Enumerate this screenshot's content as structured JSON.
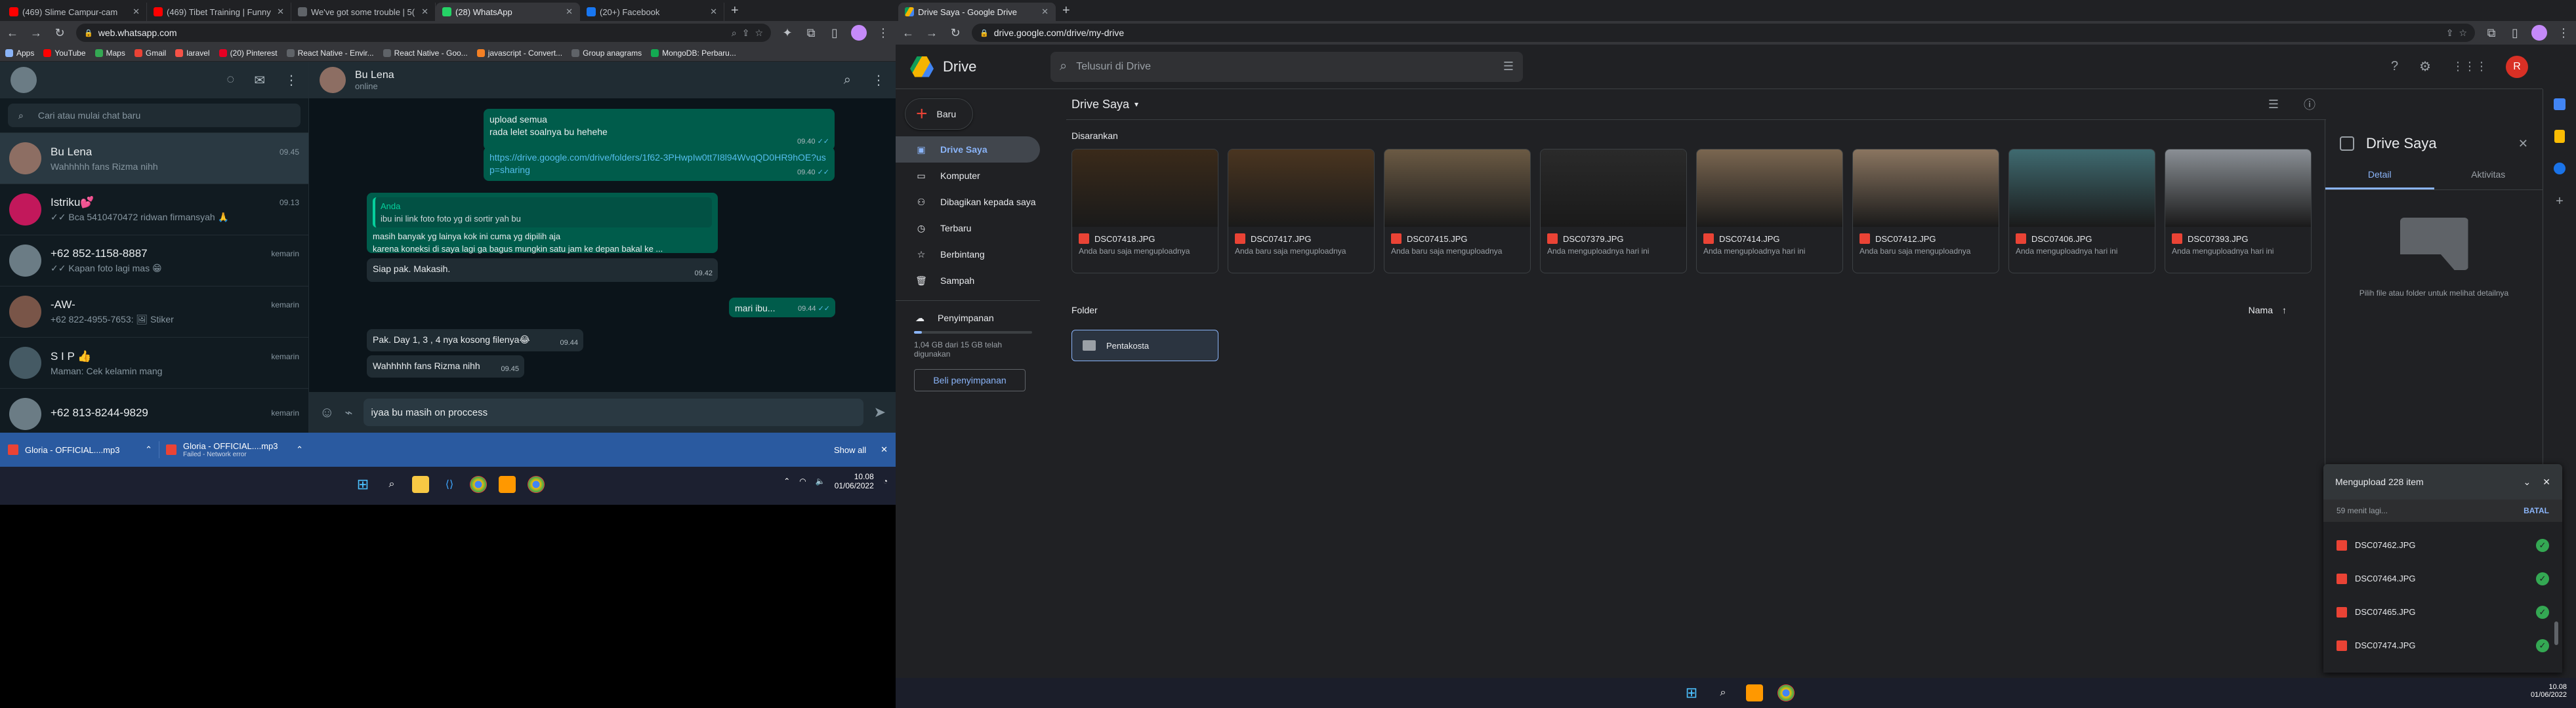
{
  "left_browser": {
    "tabs": [
      {
        "title": "(469) Slime Campur-cam",
        "color": "#ff0000"
      },
      {
        "title": "(469) Tibet Training | Funny",
        "color": "#ff0000"
      },
      {
        "title": "We've got some trouble | 5(",
        "color": "#5f6368"
      },
      {
        "title": "(28) WhatsApp",
        "color": "#25d366"
      },
      {
        "title": "(20+) Facebook",
        "color": "#1877f2"
      }
    ],
    "url": "web.whatsapp.com",
    "bookmarks": [
      {
        "label": "Apps",
        "color": "#8ab4f8"
      },
      {
        "label": "YouTube",
        "color": "#ff0000"
      },
      {
        "label": "Maps",
        "color": "#34a853"
      },
      {
        "label": "Gmail",
        "color": "#ea4335"
      },
      {
        "label": "laravel",
        "color": "#f55247"
      },
      {
        "label": "(20) Pinterest",
        "color": "#e60023"
      },
      {
        "label": "React Native - Envir...",
        "color": "#5f6368"
      },
      {
        "label": "React Native - Goo...",
        "color": "#5f6368"
      },
      {
        "label": "javascript - Convert...",
        "color": "#f48024"
      },
      {
        "label": "Group anagrams",
        "color": "#5f6368"
      },
      {
        "label": "MongoDB: Perbaru...",
        "color": "#13aa52"
      }
    ]
  },
  "whatsapp": {
    "search_placeholder": "Cari atau mulai chat baru",
    "chats": [
      {
        "name": "Bu Lena",
        "time": "09.45",
        "msg": "Wahhhhh fans Rizma nihh",
        "selected": true
      },
      {
        "name": "Istriku💕",
        "time": "09.13",
        "msg": "✓✓ Bca 5410470472  ridwan firmansyah 🙏",
        "selected": false
      },
      {
        "name": "+62 852-1158-8887",
        "time": "kemarin",
        "msg": "✓✓ Kapan foto lagi mas 😁",
        "selected": false
      },
      {
        "name": "-AW-",
        "time": "kemarin",
        "msg": "+62 822-4955-7653: 🖼 Stiker",
        "selected": false
      },
      {
        "name": "S I P 👍",
        "time": "kemarin",
        "msg": "Maman: Cek kelamin mang",
        "selected": false
      },
      {
        "name": "+62 813-8244-9829",
        "time": "kemarin",
        "msg": "",
        "selected": false
      }
    ],
    "contact": {
      "name": "Bu Lena",
      "status": "online"
    },
    "messages": {
      "m1_line1": "upload semua",
      "m1_line2": "rada lelet soalnya bu hehehe",
      "m1_time": "09.40",
      "m2_link": "https://drive.google.com/drive/folders/1f62-3PHwpIw0tt7I8l94WvqQD0HR9hOE?usp=sharing",
      "m2_time": "09.40",
      "quote_author": "Anda",
      "quote_text": "ibu ini link foto foto yg di sortir yah bu",
      "m3_line1": "masih banyak yg lainya kok ini cuma yg dipilih aja",
      "m3_line2": "karena koneksi di saya lagi ga bagus mungkin satu jam ke depan bakal ke ...",
      "m4_text": "Siap pak. Makasih.",
      "m4_time": "09.42",
      "m5_text": "mari ibu...",
      "m5_time": "09.44",
      "m6_text": "Pak. Day 1, 3 , 4 nya kosong filenya😂",
      "m6_time": "09.44",
      "m7_text": "Wahhhhh fans Rizma nihh",
      "m7_time": "09.45"
    },
    "composer_text": "iyaa bu masih on proccess"
  },
  "downloads": {
    "items": [
      {
        "name": "Gloria - OFFICIAL....mp3",
        "status": ""
      },
      {
        "name": "Gloria - OFFICIAL....mp3",
        "status": "Failed - Network error"
      }
    ],
    "show_all": "Show all"
  },
  "taskbar": {
    "time": "10.08",
    "date": "01/06/2022"
  },
  "right_browser": {
    "tab_title": "Drive Saya - Google Drive",
    "url": "drive.google.com/drive/my-drive"
  },
  "drive": {
    "logo_text": "Drive",
    "search_placeholder": "Telusuri di Drive",
    "avatar_letter": "R",
    "new_button": "Baru",
    "nav": [
      {
        "label": "Drive Saya",
        "icon": "drive-icon",
        "glyph": "▣",
        "active": true
      },
      {
        "label": "Komputer",
        "icon": "computer-icon",
        "glyph": "▭",
        "active": false
      },
      {
        "label": "Dibagikan kepada saya",
        "icon": "shared-icon",
        "glyph": "⚇",
        "active": false
      },
      {
        "label": "Terbaru",
        "icon": "clock-icon",
        "glyph": "◷",
        "active": false
      },
      {
        "label": "Berbintang",
        "icon": "star-icon",
        "glyph": "☆",
        "active": false
      },
      {
        "label": "Sampah",
        "icon": "trash-icon",
        "glyph": "🗑",
        "active": false
      }
    ],
    "storage_label": "Penyimpanan",
    "storage_usage": "1,04 GB dari 15 GB telah digunakan",
    "storage_fraction": 0.069,
    "buy_storage": "Beli penyimpanan",
    "breadcrumb": "Drive Saya",
    "suggested_label": "Disarankan",
    "suggested_files": [
      {
        "name": "DSC07418.JPG",
        "sub": "Anda baru saja mengupload­nya",
        "tone": "#3a2a1a"
      },
      {
        "name": "DSC07417.JPG",
        "sub": "Anda baru saja mengupload­nya",
        "tone": "#4a3520"
      },
      {
        "name": "DSC07415.JPG",
        "sub": "Anda baru saja mengupload­nya",
        "tone": "#6b5a44"
      },
      {
        "name": "DSC07379.JPG",
        "sub": "Anda mengupload­nya hari ini",
        "tone": "#2a2a2a"
      },
      {
        "name": "DSC07414.JPG",
        "sub": "Anda mengupload­nya hari ini",
        "tone": "#7a6650"
      },
      {
        "name": "DSC07412.JPG",
        "sub": "Anda baru saja mengupload­nya",
        "tone": "#8a7560"
      },
      {
        "name": "DSC07406.JPG",
        "sub": "Anda mengupload­nya hari ini",
        "tone": "#3f6a70"
      },
      {
        "name": "DSC07393.JPG",
        "sub": "Anda mengupload­nya hari ini",
        "tone": "#8a8f95"
      }
    ],
    "folder_label": "Folder",
    "sort_label": "Nama",
    "folders": [
      {
        "name": "Pentakosta"
      }
    ],
    "details": {
      "title": "Drive Saya",
      "tab_detail": "Detail",
      "tab_activity": "Aktivitas",
      "hint": "Pilih file atau folder untuk melihat detailnya"
    },
    "upload": {
      "title": "Mengupload 228 item",
      "eta": "59 menit lagi...",
      "cancel": "BATAL",
      "files": [
        "DSC07462.JPG",
        "DSC07464.JPG",
        "DSC07465.JPG",
        "DSC07474.JPG"
      ]
    }
  }
}
